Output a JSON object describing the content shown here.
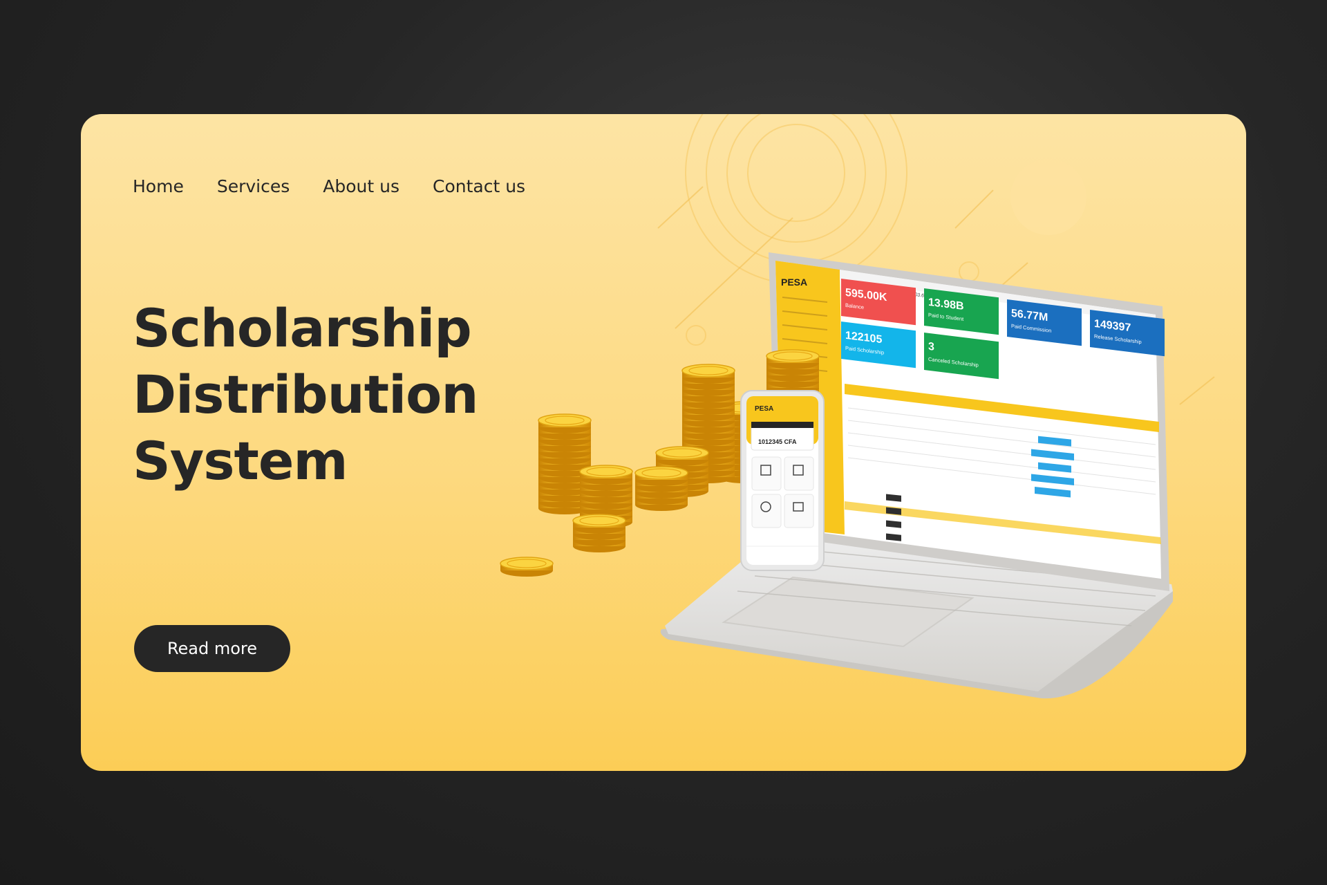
{
  "nav": {
    "items": [
      "Home",
      "Services",
      "About us",
      "Contact us"
    ]
  },
  "hero": {
    "title_lines": [
      "Scholarship",
      "Distribution",
      "System"
    ],
    "cta_label": "Read more"
  },
  "laptop": {
    "brand": "PESA",
    "ip_label": "IP Address: 103.68.4.28",
    "stats": [
      {
        "value": "595.00K",
        "label": "Balance",
        "color": "#f0504f"
      },
      {
        "value": "13.98B",
        "label": "Paid to Student",
        "color": "#18a550"
      },
      {
        "value": "56.77M",
        "label": "Paid Commission",
        "color": "#1b6fbf"
      },
      {
        "value": "149397",
        "label": "Release Scholarship",
        "color": "#1b6fbf"
      },
      {
        "value": "122105",
        "label": "Paid Scholarship",
        "color": "#13b5ea"
      },
      {
        "value": "3",
        "label": "Canceled Scholarship",
        "color": "#18a550"
      }
    ]
  },
  "phone": {
    "brand": "PESA",
    "amount": "1012345 CFA"
  },
  "colors": {
    "background": "#1f1f1f",
    "card_top": "#fde4a4",
    "card_bottom": "#fccd56",
    "accent_dark": "#262626",
    "sidebar_yellow": "#f8c61d"
  }
}
